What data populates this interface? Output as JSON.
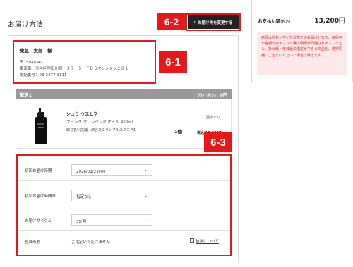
{
  "page": {
    "title": "お届け方法"
  },
  "change_button": {
    "label": "お届け先を変更する",
    "icon": "chevron-left-icon"
  },
  "tags": {
    "t1": "6-1",
    "t2": "6-2",
    "t3": "6-3"
  },
  "address": {
    "name": "東急　太郎　様",
    "postal": "〒150-0042",
    "street": "東京都　渋谷区宇田川町　３７－５　ＴＤＳマンション２０１",
    "phone": "電話番号：03-3477-3111"
  },
  "delivery": {
    "label": "配送１",
    "fee_label": "送料（税込）：",
    "fee_value": "0円"
  },
  "product": {
    "brand": "シュウ ウエムラ",
    "description": "ブラック クレンジング オイル 450ml",
    "shop": "取り扱い店舗【渋谷スクランブルスクエア】",
    "quantity": "1個",
    "unit_label": "1回あたり",
    "price": "税込 13,200円"
  },
  "settings": {
    "rows": [
      {
        "label": "初回お届け時期",
        "value": "2026/01/23(金)"
      },
      {
        "label": "初回お届け時間帯",
        "value": "指定なし"
      },
      {
        "label": "お届けサイクル",
        "value": "3か月"
      },
      {
        "label": "包装形態",
        "value": "ご指定いただけません",
        "link": "包装について"
      }
    ]
  },
  "sidebar": {
    "pay_label": "お支払い額",
    "pay_tax": "(税込)",
    "pay_value": "13,200円",
    "notice": "商品は梱包が付いた状態でのお届けとなり、商品名や金額が表示された購入明細が同梱されます。ただし、掛け紙・包装紙の指定ができる商品を、通常同梱にご注文いただいた場合は除きます。"
  },
  "colors": {
    "accent_red": "#e8181a",
    "dark_button": "#222222",
    "bar_gray": "#9a9a9a",
    "notice_bg": "#fde9e9",
    "notice_text": "#d9232a"
  }
}
